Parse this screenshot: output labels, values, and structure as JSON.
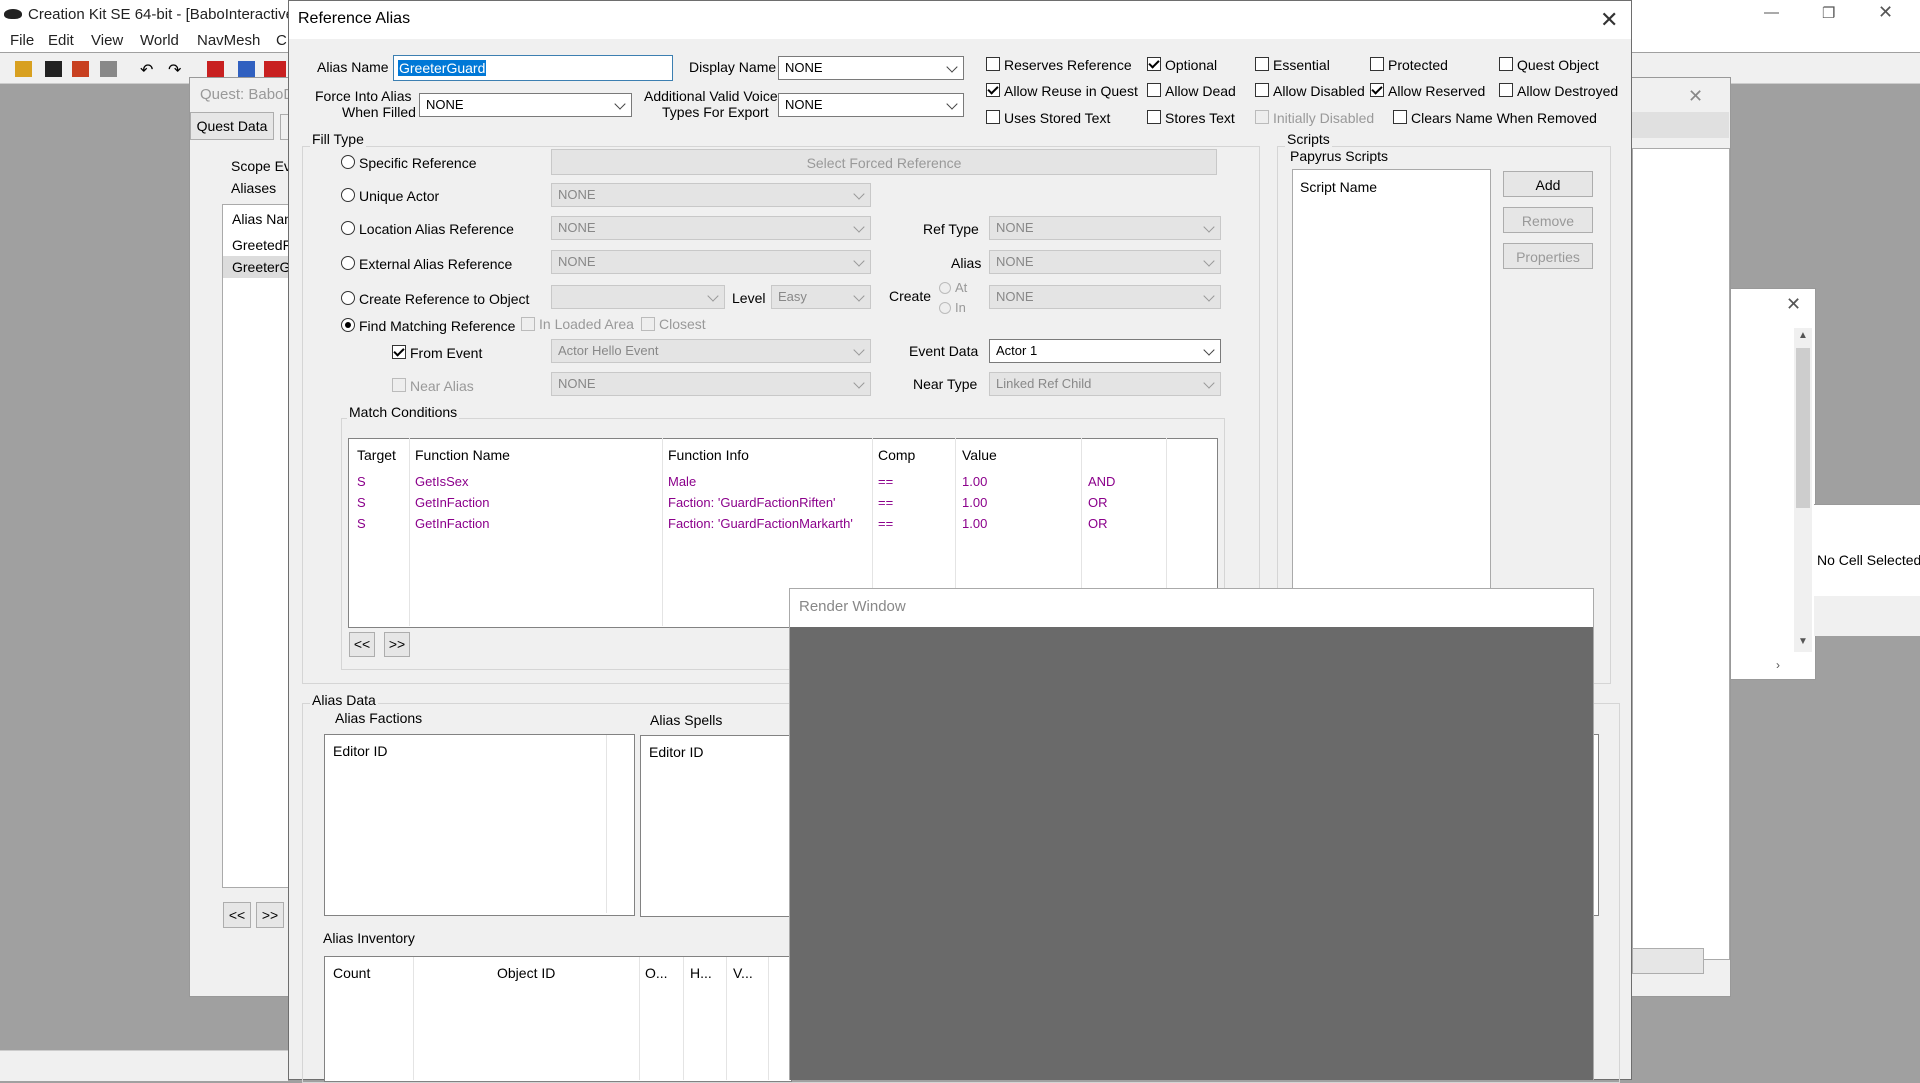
{
  "app": {
    "title": "Creation Kit SE 64-bit - [BaboInteractive",
    "menu": [
      "File",
      "Edit",
      "View",
      "World",
      "NavMesh",
      "C"
    ]
  },
  "quest_window": {
    "title": "Quest: BaboD",
    "tab": "Quest Data",
    "scope_label": "Scope Ev",
    "aliases_label": "Aliases",
    "alias_col": "Alias Nan",
    "aliases": [
      "GreetedF",
      "GreeterG"
    ],
    "prev": "<<",
    "next": ">>"
  },
  "right_window": {
    "status": "No Cell Selected"
  },
  "dialog": {
    "title": "Reference Alias",
    "alias_name_label": "Alias Name",
    "alias_name_value": "GreeterGuard",
    "display_name_label": "Display Name",
    "display_name_value": "NONE",
    "force_into_label_1": "Force Into Alias",
    "force_into_label_2": "When Filled",
    "force_into_value": "NONE",
    "additional_label_1": "Additional Valid Voice",
    "additional_label_2": "Types For Export",
    "additional_value": "NONE",
    "flags": {
      "reserves_reference": "Reserves Reference",
      "optional": "Optional",
      "essential": "Essential",
      "protected": "Protected",
      "quest_object": "Quest Object",
      "allow_reuse": "Allow Reuse in Quest",
      "allow_dead": "Allow Dead",
      "allow_disabled": "Allow Disabled",
      "allow_reserved": "Allow Reserved",
      "allow_destroyed": "Allow Destroyed",
      "uses_stored_text": "Uses Stored Text",
      "stores_text": "Stores Text",
      "initially_disabled": "Initially Disabled",
      "clears_name": "Clears Name When Removed"
    },
    "fill_type": {
      "label": "Fill Type",
      "specific_reference": "Specific Reference",
      "select_forced": "Select Forced Reference",
      "unique_actor": "Unique Actor",
      "unique_actor_value": "NONE",
      "location_alias": "Location Alias Reference",
      "location_alias_value": "NONE",
      "ref_type_label": "Ref Type",
      "ref_type_value": "NONE",
      "external_alias": "External Alias Reference",
      "external_alias_value": "NONE",
      "alias_label": "Alias",
      "alias_value": "NONE",
      "create_reference": "Create Reference to Object",
      "create_object_value": "",
      "level_label": "Level",
      "level_value": "Easy",
      "create_label": "Create",
      "create_at": "At",
      "create_in": "In",
      "create_value": "NONE",
      "find_matching": "Find Matching Reference",
      "in_loaded_area": "In Loaded Area",
      "closest": "Closest",
      "from_event": "From Event",
      "event_value": "Actor Hello Event",
      "event_data_label": "Event Data",
      "event_data_value": "Actor 1",
      "near_alias": "Near Alias",
      "near_alias_value": "NONE",
      "near_type_label": "Near Type",
      "near_type_value": "Linked Ref Child"
    },
    "match_conditions": {
      "label": "Match Conditions",
      "columns": [
        "Target",
        "Function Name",
        "Function Info",
        "Comp",
        "Value",
        ""
      ],
      "rows": [
        [
          "S",
          "GetIsSex",
          "Male",
          "==",
          "1.00",
          "AND"
        ],
        [
          "S",
          "GetInFaction",
          "Faction: 'GuardFactionRiften'",
          "==",
          "1.00",
          "OR"
        ],
        [
          "S",
          "GetInFaction",
          "Faction: 'GuardFactionMarkarth'",
          "==",
          "1.00",
          "OR"
        ]
      ],
      "prev": "<<",
      "next": ">>"
    },
    "scripts": {
      "label": "Scripts",
      "papyrus_label": "Papyrus Scripts",
      "col": "Script Name",
      "add": "Add",
      "remove": "Remove",
      "properties": "Properties"
    },
    "alias_data": {
      "label": "Alias Data",
      "factions_label": "Alias Factions",
      "factions_col": "Editor ID",
      "spells_label": "Alias Spells",
      "spells_col": "Editor ID",
      "inventory_label": "Alias Inventory",
      "inventory_cols": [
        "Count",
        "Object ID",
        "O...",
        "H...",
        "V..."
      ]
    }
  },
  "render_window": {
    "title": "Render Window"
  }
}
